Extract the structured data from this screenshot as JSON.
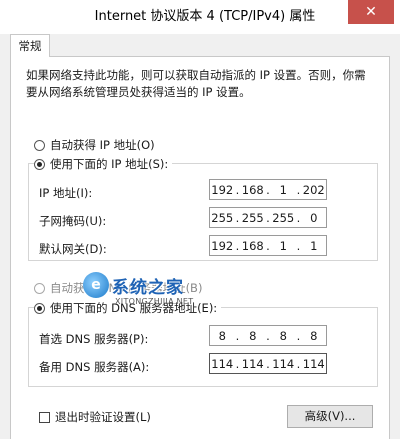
{
  "window": {
    "title": "Internet 协议版本 4 (TCP/IPv4) 属性",
    "close_glyph": "✕"
  },
  "tabs": [
    {
      "label": "常规"
    }
  ],
  "description": "如果网络支持此功能，则可以获取自动指派的 IP 设置。否则，你需要从网络系统管理员处获得适当的 IP 设置。",
  "ip_section": {
    "auto_label": "自动获得 IP 地址(O)",
    "manual_label": "使用下面的 IP 地址(S):",
    "manual_selected": true,
    "fields": [
      {
        "label": "IP 地址(I):",
        "value": [
          "192",
          "168",
          "1",
          "202"
        ]
      },
      {
        "label": "子网掩码(U):",
        "value": [
          "255",
          "255",
          "255",
          "0"
        ]
      },
      {
        "label": "默认网关(D):",
        "value": [
          "192",
          "168",
          "1",
          "1"
        ]
      }
    ]
  },
  "dns_section": {
    "auto_label": "自动获得 DNS 服务器地址(B)",
    "manual_label": "使用下面的 DNS 服务器地址(E):",
    "fields": [
      {
        "label": "首选 DNS 服务器(P):",
        "value": [
          "8",
          "8",
          "8",
          "8"
        ]
      },
      {
        "label": "备用 DNS 服务器(A):",
        "value": [
          "114",
          "114",
          "114",
          "114"
        ]
      }
    ]
  },
  "validate_label": "退出时验证设置(L)",
  "advanced_label": "高级(V)...",
  "watermark": {
    "logo": "e",
    "text": "系统之家",
    "url": "XITONGZHIJIA.NET"
  }
}
